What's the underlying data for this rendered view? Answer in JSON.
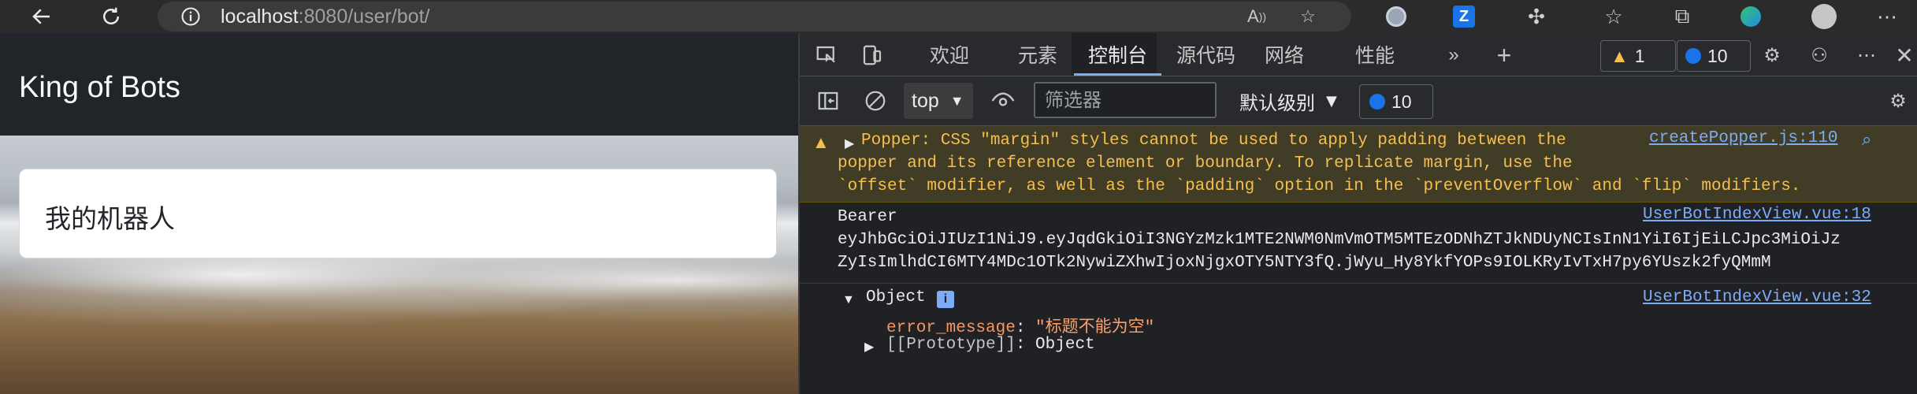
{
  "browser": {
    "url_host": "localhost",
    "url_path": ":8080/user/bot/"
  },
  "page": {
    "brand": "King of Bots",
    "card_title": "我的机器人"
  },
  "devtools": {
    "tabs": [
      "欢迎",
      "元素",
      "控制台",
      "源代码",
      "网络",
      "性能"
    ],
    "active_tab": "控制台",
    "warning_count": "1",
    "message_count": "10",
    "context": "top",
    "filter_placeholder": "筛选器",
    "levels_label": "默认级别",
    "toolbar_message_count": "10",
    "warning": {
      "line1": "Popper: CSS \"margin\" styles cannot be used to apply padding between the",
      "line2": "popper and its reference element or boundary. To replicate margin, use the",
      "line3": "`offset` modifier, as well as the `padding` option in the `preventOverflow` and `flip` modifiers.",
      "source": "createPopper.js:110"
    },
    "log1": {
      "line1": "Bearer",
      "line2": "eyJhbGciOiJIUzI1NiJ9.eyJqdGkiOiI3NGYzMzk1MTE2NWM0NmVmOTM5MTEzODNhZTJkNDUyNCIsInN1YiI6IjEiLCJpc3MiOiJz",
      "line3": "ZyIsImlhdCI6MTY4MDc1OTk2NywiZXhwIjoxNjgxOTY5NTY3fQ.jWyu_Hy8YkfYOPs9IOLKRyIvTxH7py6YUszk2fyQMmM",
      "source": "UserBotIndexView.vue:18"
    },
    "log2": {
      "object_label": "Object",
      "key": "error_message",
      "value": "\"标题不能为空\"",
      "proto_key": "[[Prototype]]",
      "proto_value": "Object",
      "source": "UserBotIndexView.vue:32"
    }
  },
  "colors": {
    "accent": "#7cacf8",
    "warning_bg": "#413c26",
    "warning_text": "#f4bf4f"
  }
}
